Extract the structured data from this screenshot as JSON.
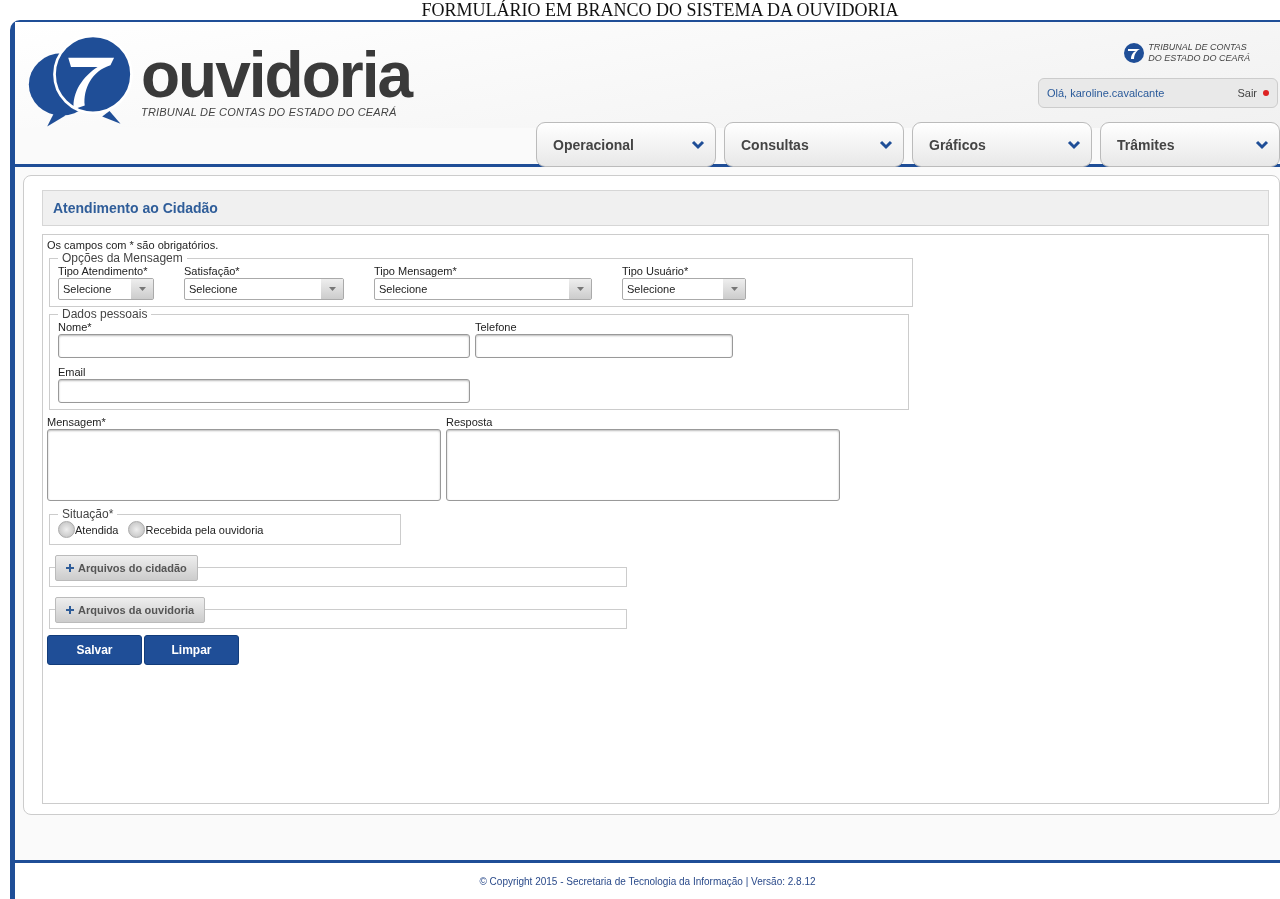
{
  "caption": "FORMULÁRIO EM BRANCO DO SISTEMA DA OUVIDORIA",
  "header": {
    "logo_text": "ouvidoria",
    "logo_subtitle": "TRIBUNAL DE CONTAS DO ESTADO DO CEARÁ",
    "org_logo_lines": [
      "TRIBUNAL DE CONTAS",
      "DO ESTADO DO CEARÁ"
    ],
    "greeting": "Olá, karoline.cavalcante",
    "logout": "Sair"
  },
  "nav": [
    {
      "label": "Operacional"
    },
    {
      "label": "Consultas"
    },
    {
      "label": "Gráficos"
    },
    {
      "label": "Trâmites"
    }
  ],
  "panel": {
    "title": "Atendimento ao Cidadão",
    "note": "Os campos com * são obrigatórios.",
    "options": {
      "legend": "Opções da Mensagem",
      "selects": [
        {
          "label": "Tipo Atendimento*",
          "value": "Selecione"
        },
        {
          "label": "Satisfação*",
          "value": "Selecione"
        },
        {
          "label": "Tipo Mensagem*",
          "value": "Selecione"
        },
        {
          "label": "Tipo Usuário*",
          "value": "Selecione"
        }
      ]
    },
    "personal": {
      "legend": "Dados pessoais",
      "fields": [
        {
          "label": "Nome*"
        },
        {
          "label": "Telefone"
        },
        {
          "label": "Email"
        }
      ]
    },
    "textareas": [
      {
        "label": "Mensagem*"
      },
      {
        "label": "Resposta"
      }
    ],
    "situation": {
      "legend": "Situação*",
      "options": [
        {
          "label": "Atendida",
          "selected": false
        },
        {
          "label": "Recebida pela ouvidoria",
          "selected": false
        }
      ]
    },
    "attachments": [
      {
        "label": "Arquivos do cidadão",
        "expanded": false
      },
      {
        "label": "Arquivos da ouvidoria",
        "expanded": false
      }
    ],
    "buttons": [
      "Salvar",
      "Limpar"
    ]
  },
  "footer": "© Copyright 2015 - Secretaria de Tecnologia da Informação | Versão: 2.8.12"
}
